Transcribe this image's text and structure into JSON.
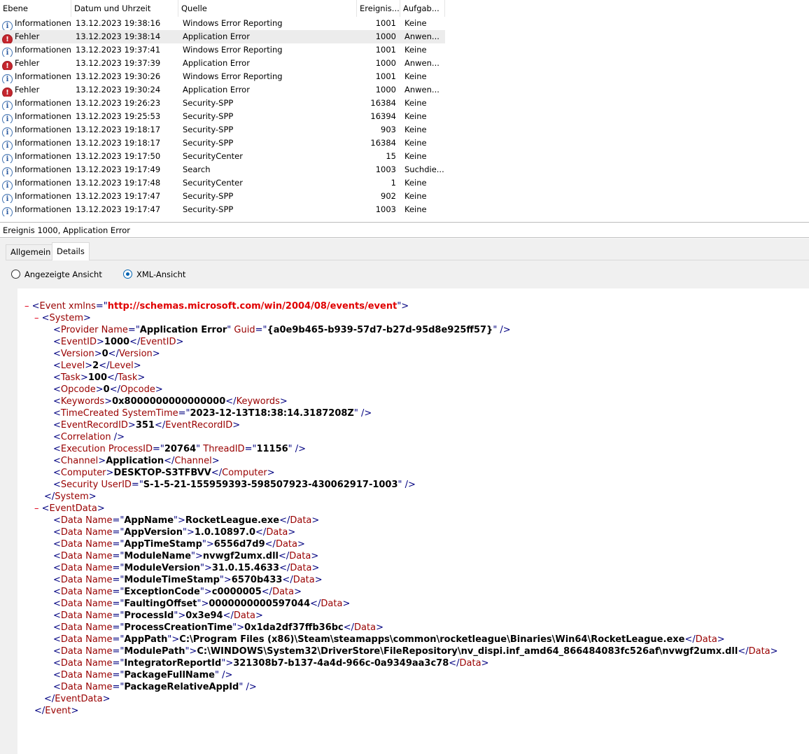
{
  "list": {
    "columns": [
      "Ebene",
      "Datum und Uhrzeit",
      "Quelle",
      "Ereignis...",
      "Aufgab..."
    ],
    "rows": [
      {
        "level": "Informationen",
        "type": "info",
        "date": "13.12.2023 19:38:16",
        "source": "Windows Error Reporting",
        "id": "1001",
        "task": "Keine"
      },
      {
        "level": "Fehler",
        "type": "error",
        "date": "13.12.2023 19:38:14",
        "source": "Application Error",
        "id": "1000",
        "task": "Anwen..."
      },
      {
        "level": "Informationen",
        "type": "info",
        "date": "13.12.2023 19:37:41",
        "source": "Windows Error Reporting",
        "id": "1001",
        "task": "Keine"
      },
      {
        "level": "Fehler",
        "type": "error",
        "date": "13.12.2023 19:37:39",
        "source": "Application Error",
        "id": "1000",
        "task": "Anwen..."
      },
      {
        "level": "Informationen",
        "type": "info",
        "date": "13.12.2023 19:30:26",
        "source": "Windows Error Reporting",
        "id": "1001",
        "task": "Keine"
      },
      {
        "level": "Fehler",
        "type": "error",
        "date": "13.12.2023 19:30:24",
        "source": "Application Error",
        "id": "1000",
        "task": "Anwen..."
      },
      {
        "level": "Informationen",
        "type": "info",
        "date": "13.12.2023 19:26:23",
        "source": "Security-SPP",
        "id": "16384",
        "task": "Keine"
      },
      {
        "level": "Informationen",
        "type": "info",
        "date": "13.12.2023 19:25:53",
        "source": "Security-SPP",
        "id": "16394",
        "task": "Keine"
      },
      {
        "level": "Informationen",
        "type": "info",
        "date": "13.12.2023 19:18:17",
        "source": "Security-SPP",
        "id": "903",
        "task": "Keine"
      },
      {
        "level": "Informationen",
        "type": "info",
        "date": "13.12.2023 19:18:17",
        "source": "Security-SPP",
        "id": "16384",
        "task": "Keine"
      },
      {
        "level": "Informationen",
        "type": "info",
        "date": "13.12.2023 19:17:50",
        "source": "SecurityCenter",
        "id": "15",
        "task": "Keine"
      },
      {
        "level": "Informationen",
        "type": "info",
        "date": "13.12.2023 19:17:49",
        "source": "Search",
        "id": "1003",
        "task": "Suchdie..."
      },
      {
        "level": "Informationen",
        "type": "info",
        "date": "13.12.2023 19:17:48",
        "source": "SecurityCenter",
        "id": "1",
        "task": "Keine"
      },
      {
        "level": "Informationen",
        "type": "info",
        "date": "13.12.2023 19:17:47",
        "source": "Security-SPP",
        "id": "902",
        "task": "Keine"
      },
      {
        "level": "Informationen",
        "type": "info",
        "date": "13.12.2023 19:17:47",
        "source": "Security-SPP",
        "id": "1003",
        "task": "Keine"
      }
    ],
    "selected_index": 1
  },
  "detail": {
    "title": "Ereignis 1000, Application Error",
    "tabs": [
      "Allgemein",
      "Details"
    ],
    "active_tab": 1,
    "view_options": [
      "Angezeigte Ansicht",
      "XML-Ansicht"
    ],
    "selected_view": 1
  },
  "icons": {
    "info": "information-icon",
    "error": "error-icon",
    "collapse": "collapse-toggle"
  },
  "colors": {
    "tag": "#000080",
    "name": "#990000",
    "toggle": "#e0001a",
    "selection": "#ececec",
    "radio": "#0063b1"
  },
  "xml": {
    "event_xmlns": "http://schemas.microsoft.com/win/2004/08/events/event",
    "provider_name": "Application Error",
    "provider_guid": "{a0e9b465-b939-57d7-b27d-95d8e925ff57}",
    "event_id": "1000",
    "version": "0",
    "level": "2",
    "task": "100",
    "opcode": "0",
    "keywords": "0x8000000000000000",
    "time_created": "2023-12-13T18:38:14.3187208Z",
    "record_id": "351",
    "process_id": "20764",
    "thread_id": "11156",
    "channel": "Application",
    "computer": "DESKTOP-S3TFBVV",
    "user_id": "S-1-5-21-155959393-598507923-430062917-1003",
    "data": [
      {
        "name": "AppName",
        "value": "RocketLeague.exe"
      },
      {
        "name": "AppVersion",
        "value": "1.0.10897.0"
      },
      {
        "name": "AppTimeStamp",
        "value": "6556d7d9"
      },
      {
        "name": "ModuleName",
        "value": "nvwgf2umx.dll"
      },
      {
        "name": "ModuleVersion",
        "value": "31.0.15.4633"
      },
      {
        "name": "ModuleTimeStamp",
        "value": "6570b433"
      },
      {
        "name": "ExceptionCode",
        "value": "c0000005"
      },
      {
        "name": "FaultingOffset",
        "value": "0000000000597044"
      },
      {
        "name": "ProcessId",
        "value": "0x3e94"
      },
      {
        "name": "ProcessCreationTime",
        "value": "0x1da2df37ffb36bc"
      },
      {
        "name": "AppPath",
        "value": "C:\\Program Files (x86)\\Steam\\steamapps\\common\\rocketleague\\Binaries\\Win64\\RocketLeague.exe"
      },
      {
        "name": "ModulePath",
        "value": "C:\\WINDOWS\\System32\\DriverStore\\FileRepository\\nv_dispi.inf_amd64_866484083fc526af\\nvwgf2umx.dll"
      },
      {
        "name": "IntegratorReportId",
        "value": "321308b7-b137-4a4d-966c-0a9349aa3c78"
      },
      {
        "name": "PackageFullName",
        "value": ""
      },
      {
        "name": "PackageRelativeAppId",
        "value": ""
      }
    ]
  }
}
